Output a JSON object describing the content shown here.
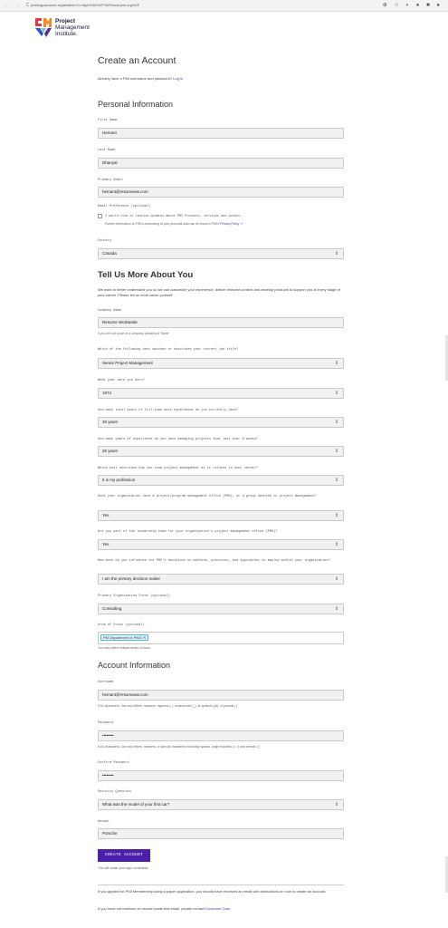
{
  "browser": {
    "nav": "← → C ⌂",
    "url": "pmi.org/account-registration?r=https%3A%2F%2Fwww.pmi.org%2F",
    "extensions": "⊕ ☆ ◐ ● ■ ●"
  },
  "logo": {
    "line1": "Project",
    "line2": "Management",
    "line3": "Institute."
  },
  "header": {
    "title": "Create an Account",
    "login_prompt": "Already have a PMI username and password?",
    "login_link": "Log in"
  },
  "personal": {
    "title": "Personal Information",
    "first_name_label": "First Name",
    "first_name": "Hemant",
    "last_name_label": "Last Name",
    "last_name": "Dhanyal",
    "email_label": "Primary Email",
    "email": "hemant@resumeww.com",
    "pref_label": "Email Preference (optional)",
    "pref_text": "I would like to receive updates about PMI Products, services and events.",
    "privacy_text": "Further information on PMI's processing of your personal data can be found in PMI's",
    "privacy_link": "Privacy Policy",
    "country_label": "Country",
    "country": "Canada"
  },
  "more": {
    "title": "Tell Us More About You",
    "intro": "We want to better understand you so we can customize your experience, deliver relevant content and develop products to support you at every stage of your career. Please tell us more about yourself.",
    "company_label": "Company Name",
    "company": "Resume Worldwide",
    "company_help": "If you are not a part of a company, please put \"None\"",
    "job_label": "Which of the following best matches or describes your current job title?",
    "job": "Senior Project Management",
    "born_label": "What year were you born?",
    "born": "1974",
    "exp_label": "How many total years of full-time work experience do you currently have?",
    "exp": "30 years",
    "pm_exp_label": "How many years of experience do you have managing projects that last over 6 weeks?",
    "pm_exp": "25 years",
    "view_label": "Which best describes how you view project management as it relates to your career?",
    "view": "It is my profession",
    "pmo_label": "Does your organization have a project/program management office (PMO), or a group devoted to project management?",
    "pmo": "Yes",
    "leader_label": "Are you part of the leadership team for your organization's project management office (PMO)?",
    "leader": "Yes",
    "influence_label": "How much do you influence the PMI's decisions on methods, practices, and approaches to employ within your organization?",
    "influence": "I am the primary decision maker",
    "focus_label": "Primary Organization Focus (optional)",
    "focus": "Consulting",
    "area_label": "Area of Focus (optional)",
    "area_tag": "PM Department or PMO",
    "area_help": "You may select multiple areas of focus."
  },
  "account": {
    "title": "Account Information",
    "username_label": "Username",
    "username": "hemant@resumeww.com",
    "username_help": "5-50 characters. Use only letters, numbers, hyphens (-), underscores (_), at symbols (@), or periods (.)",
    "password_label": "Password",
    "password": "••••••••",
    "password_help": "5-60 characters. Use only letters, numbers, or special characters excluding spaces, angle brackets (< >) and periods (.)",
    "confirm_label": "Confirm Password",
    "confirm": "••••••••",
    "question_label": "Security Question",
    "question": "What was the model of your first car?",
    "answer_label": "Answer",
    "answer": "Porsche",
    "submit": "CREATE ACCOUNT",
    "submit_help": "This will create your login credentials"
  },
  "footer": {
    "note1": "If you applied for PMI Membership using a paper application, you should have received an email with instructions on how to create an account.",
    "note2": "If you have not received or cannot locate this email, please contact",
    "care_link": "Customer Care"
  },
  "colors": {
    "accent": "#4b1fa8",
    "link": "#3a3ac2",
    "tag_bg": "#dff4f8"
  }
}
